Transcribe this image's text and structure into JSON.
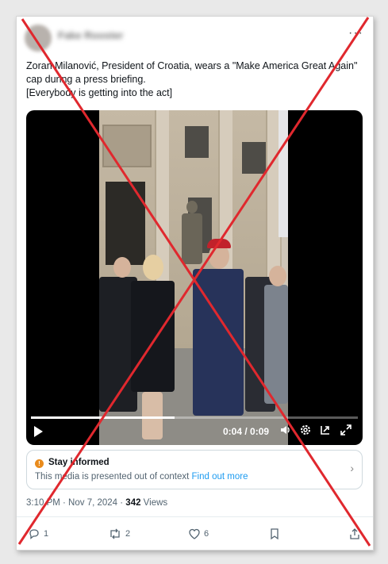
{
  "post": {
    "author_name": "Fake Rooster",
    "more": "···",
    "text_line1": "Zoran Milanović, President of Croatia, wears a \"Make America Great Again\" cap during a press briefing.",
    "text_line2": "[Everybody is getting into the act]"
  },
  "video": {
    "time": "0:04 / 0:09",
    "progress_fraction": 0.44
  },
  "notice": {
    "title": "Stay informed",
    "description": "This media is presented out of context",
    "link": "Find out more"
  },
  "meta": {
    "time_date": "3:10 PM · Nov 7, 2024 · ",
    "views_count": "342",
    "views_label": " Views"
  },
  "actions": {
    "replies": "1",
    "reposts": "2",
    "likes": "6"
  },
  "colors": {
    "cross": "#e0282e",
    "link": "#1d9bf0",
    "notice_icon": "#e98b1c"
  }
}
